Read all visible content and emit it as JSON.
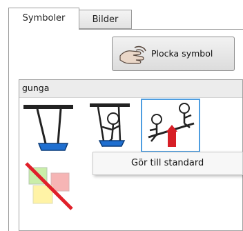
{
  "tabs": [
    {
      "label": "Symboler",
      "selected": true
    },
    {
      "label": "Bilder",
      "selected": false
    }
  ],
  "pick_button": {
    "label": "Plocka symbol",
    "icon": "hand-icon"
  },
  "symbol_group": {
    "title": "gunga",
    "symbols": [
      {
        "icon": "swing-icon",
        "selected": false
      },
      {
        "icon": "person-on-swing-icon",
        "selected": false
      },
      {
        "icon": "seesaw-icon",
        "selected": true
      },
      {
        "icon": "no-symbol-icon",
        "selected": false
      }
    ]
  },
  "context_menu": {
    "items": [
      {
        "label": "Gör till standard"
      }
    ]
  },
  "colors": {
    "selection": "#4d9de0",
    "header_bg": "#ececec",
    "seat_blue": "#1f6fd0",
    "no_symbol_red": "#e0202a"
  }
}
